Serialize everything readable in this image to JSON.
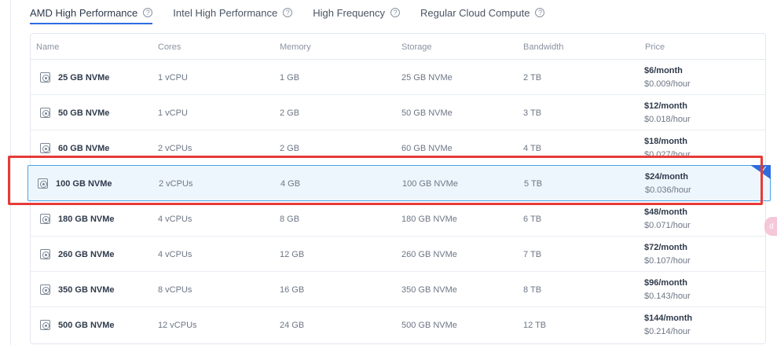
{
  "tabs": [
    {
      "label": "AMD High Performance",
      "active": true
    },
    {
      "label": "Intel High Performance",
      "active": false
    },
    {
      "label": "High Frequency",
      "active": false
    },
    {
      "label": "Regular Cloud Compute",
      "active": false
    }
  ],
  "help_glyph": "?",
  "columns": {
    "name": "Name",
    "cores": "Cores",
    "memory": "Memory",
    "storage": "Storage",
    "bandwidth": "Bandwidth",
    "price": "Price"
  },
  "plans": [
    {
      "name": "25 GB NVMe",
      "cores": "1 vCPU",
      "memory": "1 GB",
      "storage": "25 GB NVMe",
      "bandwidth": "2 TB",
      "monthly": "$6/month",
      "hourly": "$0.009/hour"
    },
    {
      "name": "50 GB NVMe",
      "cores": "1 vCPU",
      "memory": "2 GB",
      "storage": "50 GB NVMe",
      "bandwidth": "3 TB",
      "monthly": "$12/month",
      "hourly": "$0.018/hour"
    },
    {
      "name": "60 GB NVMe",
      "cores": "2 vCPUs",
      "memory": "2 GB",
      "storage": "60 GB NVMe",
      "bandwidth": "4 TB",
      "monthly": "$18/month",
      "hourly": "$0.027/hour"
    },
    {
      "name": "100 GB NVMe",
      "cores": "2 vCPUs",
      "memory": "4 GB",
      "storage": "100 GB NVMe",
      "bandwidth": "5 TB",
      "monthly": "$24/month",
      "hourly": "$0.036/hour",
      "selected": true
    },
    {
      "name": "180 GB NVMe",
      "cores": "4 vCPUs",
      "memory": "8 GB",
      "storage": "180 GB NVMe",
      "bandwidth": "6 TB",
      "monthly": "$48/month",
      "hourly": "$0.071/hour"
    },
    {
      "name": "260 GB NVMe",
      "cores": "4 vCPUs",
      "memory": "12 GB",
      "storage": "260 GB NVMe",
      "bandwidth": "7 TB",
      "monthly": "$72/month",
      "hourly": "$0.107/hour"
    },
    {
      "name": "350 GB NVMe",
      "cores": "8 vCPUs",
      "memory": "16 GB",
      "storage": "350 GB NVMe",
      "bandwidth": "8 TB",
      "monthly": "$96/month",
      "hourly": "$0.143/hour"
    },
    {
      "name": "500 GB NVMe",
      "cores": "12 vCPUs",
      "memory": "24 GB",
      "storage": "500 GB NVMe",
      "bandwidth": "12 TB",
      "monthly": "$144/month",
      "hourly": "$0.214/hour"
    }
  ],
  "selected_check": "✓",
  "float_badge_text": "d"
}
